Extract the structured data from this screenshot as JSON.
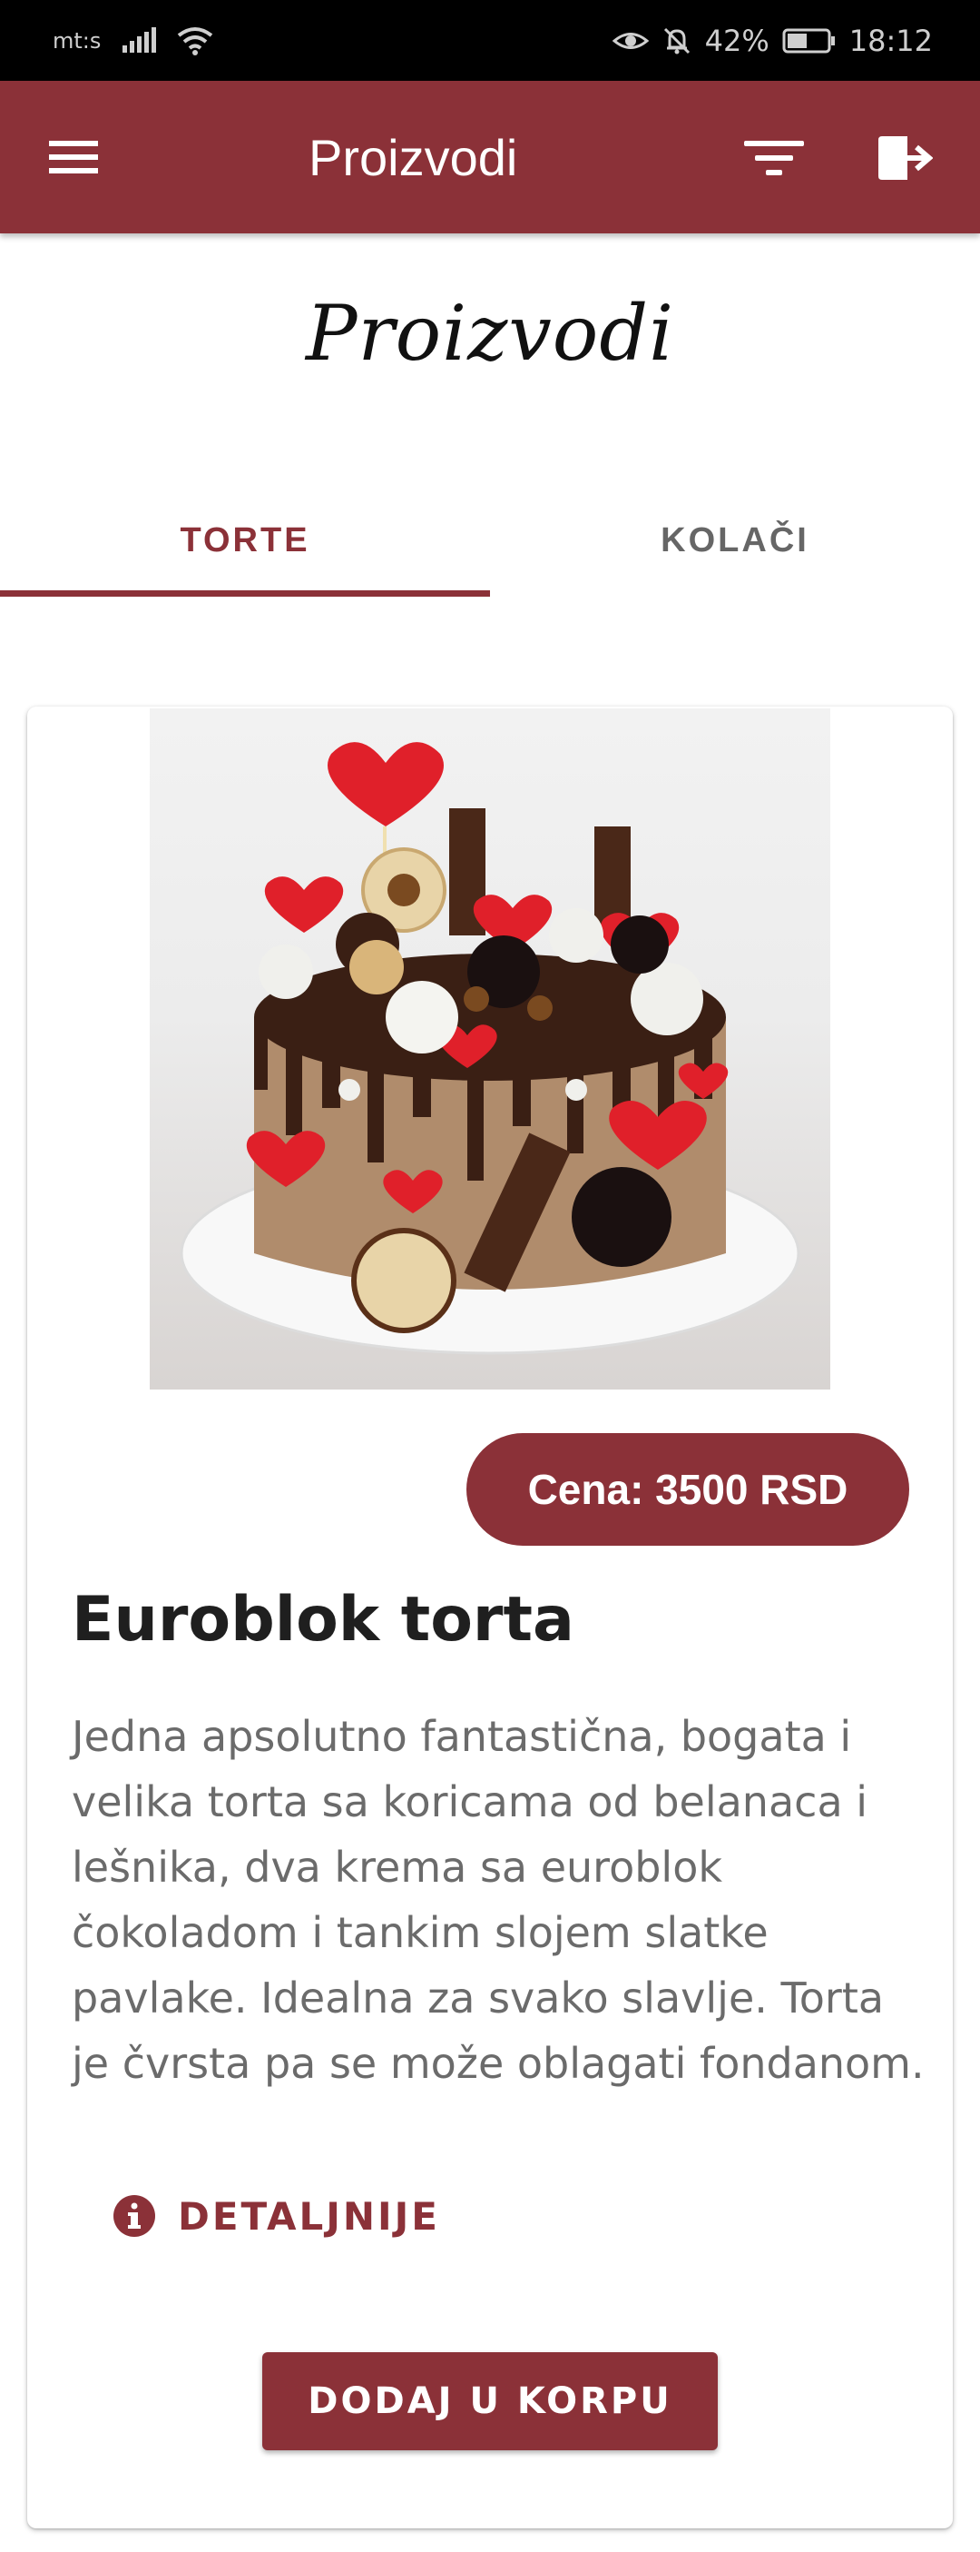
{
  "status_bar": {
    "carrier": "mt:s",
    "battery_percent": "42%",
    "time": "18:12",
    "icons": [
      "signal-icon",
      "wifi-icon",
      "eye-icon",
      "mute-bell-icon",
      "battery-icon"
    ]
  },
  "app_bar": {
    "title": "Proizvodi",
    "icons": [
      "menu-icon",
      "filter-icon",
      "logout-icon"
    ]
  },
  "page": {
    "heading": "Proizvodi"
  },
  "tabs": [
    {
      "label": "TORTE",
      "selected": true
    },
    {
      "label": "KOLAČI",
      "selected": false
    }
  ],
  "product": {
    "price": "Cena: 3500 RSD",
    "name": "Euroblok torta",
    "description": "Jedna apsolutno fantastična, bogata i velika torta sa koricama od belanaca i lešnika, dva krema sa euroblok čokoladom i tankim slojem slatke pavlake. Idealna za svako slavlje. Torta je čvrsta pa se može oblagati fondanom.",
    "details_label": "DETALJNIJE",
    "add_to_cart_label": "DODAJ U KORPU"
  },
  "colors": {
    "primary": "#8b3138",
    "status_bar": "#000000",
    "heading_text": "#1f1f1f",
    "body_text": "#6b6b6b"
  }
}
